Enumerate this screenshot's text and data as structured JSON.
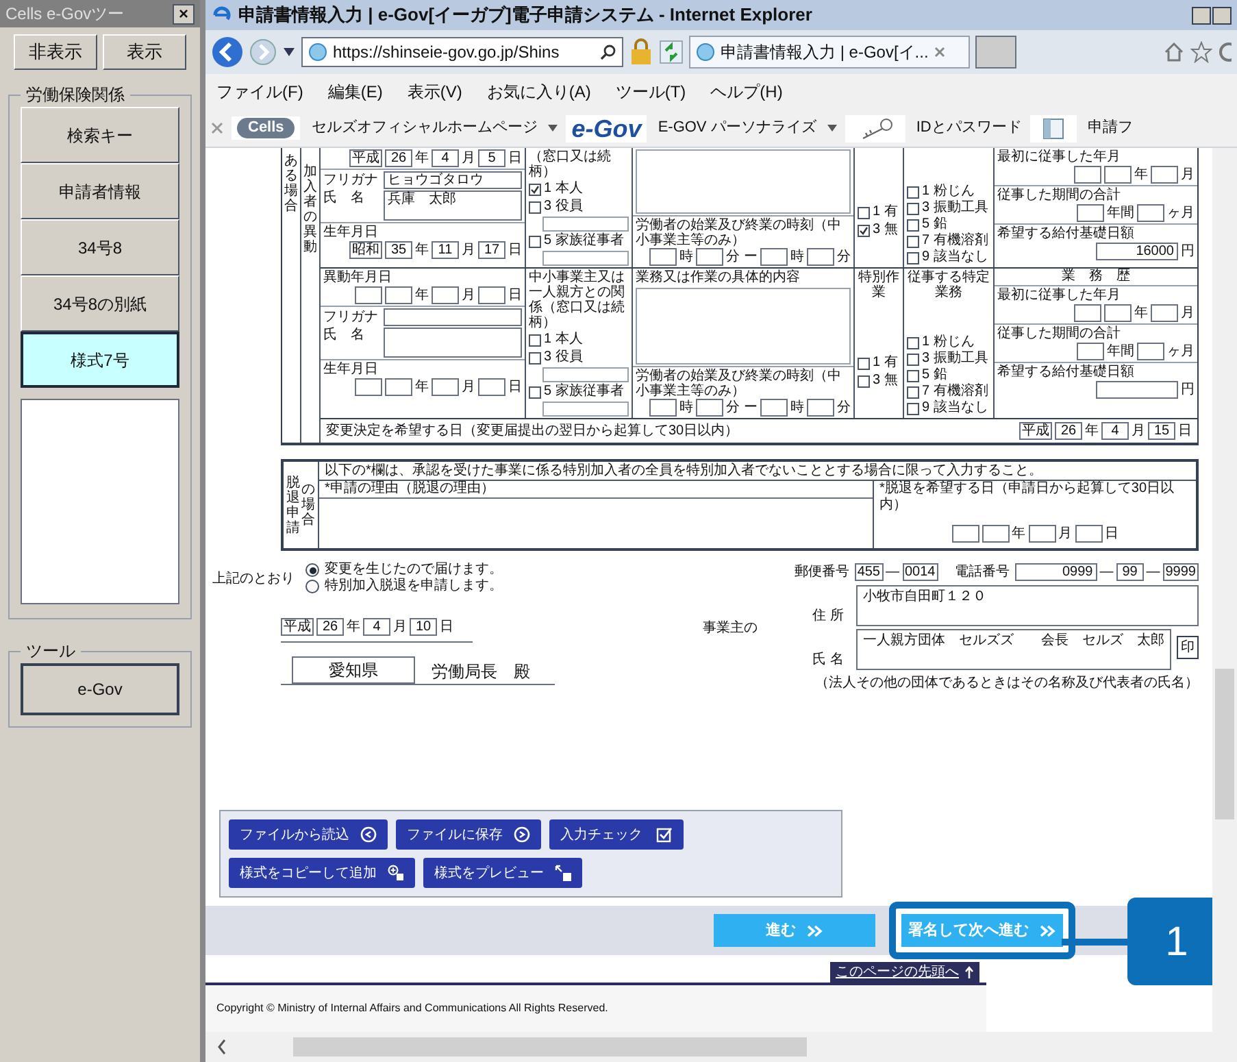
{
  "side_panel": {
    "title": "Cells e-Govツー",
    "close": "×",
    "toggle_buttons": [
      {
        "label": "非表示"
      },
      {
        "label": "表示"
      }
    ],
    "group_title": "労働保険関係",
    "items": [
      {
        "label": "検索キー",
        "selected": false
      },
      {
        "label": "申請者情報",
        "selected": false
      },
      {
        "label": "34号8",
        "selected": false
      },
      {
        "label": "34号8の別紙",
        "selected": false
      },
      {
        "label": "様式7号",
        "selected": true
      }
    ],
    "tool_group_title": "ツール",
    "tool_button": "e-Gov"
  },
  "browser": {
    "title": "申請書情報入力 | e-Gov[イーガブ]電子申請システム - Internet Explorer",
    "address": "https://shinseie-gov.go.jp/Shins",
    "tab": "申請書情報入力 | e-Gov[イ...",
    "menu": [
      "ファイル(F)",
      "編集(E)",
      "表示(V)",
      "お気に入り(A)",
      "ツール(T)",
      "ヘルプ(H)"
    ],
    "favorites": [
      {
        "kind": "cells",
        "logo": "Cells",
        "label": "セルズオフィシャルホームページ",
        "dropdown": true
      },
      {
        "kind": "egov",
        "logo": "e-Gov",
        "label": "E-GOV パーソナライズ",
        "dropdown": true
      },
      {
        "kind": "key",
        "label": "IDとパスワード",
        "dropdown": false
      },
      {
        "kind": "book",
        "label": "申請フ",
        "dropdown": false
      }
    ]
  },
  "form": {
    "outer_label": "ある場合",
    "inner_label": "加入者の異動",
    "persons": [
      {
        "date": [
          {
            "kind": "box",
            "value": "平成"
          },
          {
            "kind": "box",
            "value": "26"
          },
          {
            "kind": "unit",
            "text": "年"
          },
          {
            "kind": "box",
            "value": "4"
          },
          {
            "kind": "unit",
            "text": "月"
          },
          {
            "kind": "box",
            "value": "5"
          },
          {
            "kind": "unit",
            "text": "日"
          }
        ],
        "furigana_label": "フリガナ",
        "furigana": "ヒョウゴタロウ",
        "name_label": "氏　名",
        "name": "兵庫　太郎",
        "birth_label": "生年月日",
        "birth": [
          {
            "kind": "box",
            "value": "昭和"
          },
          {
            "kind": "box",
            "value": "35"
          },
          {
            "kind": "unit",
            "text": "年"
          },
          {
            "kind": "box",
            "value": "11"
          },
          {
            "kind": "unit",
            "text": "月"
          },
          {
            "kind": "box",
            "value": "17"
          },
          {
            "kind": "unit",
            "text": "日"
          }
        ],
        "relation_label": "（窓口又は続柄）",
        "relations": [
          {
            "label": "1 本人",
            "checked": true
          },
          {
            "label": "3 役員",
            "checked": false
          },
          {
            "label": "5 家族従事者",
            "checked": false
          }
        ],
        "hours_label": "労働者の始業及び終業の時刻（中小事業主等のみ）",
        "hours": [
          {
            "kind": "box"
          },
          {
            "kind": "unit",
            "text": "時"
          },
          {
            "kind": "box"
          },
          {
            "kind": "unit",
            "text": "分 ー"
          },
          {
            "kind": "box"
          },
          {
            "kind": "unit",
            "text": "時"
          },
          {
            "kind": "box"
          },
          {
            "kind": "unit",
            "text": "分"
          }
        ],
        "specials": [
          {
            "label": "1 有",
            "checked": false
          },
          {
            "label": "3 無",
            "checked": true
          }
        ],
        "jobs": [
          {
            "label": "1 粉じん",
            "checked": false
          },
          {
            "label": "3 振動工具",
            "checked": false
          },
          {
            "label": "5 鉛",
            "checked": false
          },
          {
            "label": "7 有機溶剤",
            "checked": false
          },
          {
            "label": "9 該当なし",
            "checked": false
          }
        ],
        "first_label": "最初に従事した年月",
        "first": [
          {
            "kind": "box"
          },
          {
            "kind": "box"
          },
          {
            "kind": "unit",
            "text": "年"
          },
          {
            "kind": "box"
          },
          {
            "kind": "unit",
            "text": "月"
          }
        ],
        "period_label": "従事した期間の合計",
        "period": [
          {
            "kind": "box"
          },
          {
            "kind": "unit",
            "text": "年間"
          },
          {
            "kind": "box"
          },
          {
            "kind": "unit",
            "text": "ヶ月"
          }
        ],
        "daily_label": "希望する給付基礎日額",
        "daily": [
          {
            "kind": "wide",
            "value": "16000"
          },
          {
            "kind": "unit",
            "text": "円"
          }
        ]
      },
      {
        "date_label": "異動年月日",
        "date": [
          {
            "kind": "box"
          },
          {
            "kind": "box"
          },
          {
            "kind": "unit",
            "text": "年"
          },
          {
            "kind": "box"
          },
          {
            "kind": "unit",
            "text": "月"
          },
          {
            "kind": "box"
          },
          {
            "kind": "unit",
            "text": "日"
          }
        ],
        "furigana_label": "フリガナ",
        "name_label": "氏　名",
        "birth_label": "生年月日",
        "birth": [
          {
            "kind": "box"
          },
          {
            "kind": "box"
          },
          {
            "kind": "unit",
            "text": "年"
          },
          {
            "kind": "box"
          },
          {
            "kind": "unit",
            "text": "月"
          },
          {
            "kind": "box"
          },
          {
            "kind": "unit",
            "text": "日"
          }
        ],
        "relation_label": "中小事業主又は一人親方との関係（窓口又は続柄）",
        "relations": [
          {
            "label": "1 本人",
            "checked": false
          },
          {
            "label": "3 役員",
            "checked": false
          },
          {
            "label": "5 家族従事者",
            "checked": false
          }
        ],
        "work_label": "業務又は作業の具体的内容",
        "hours_label": "労働者の始業及び終業の時刻（中小事業主等のみ）",
        "hours": [
          {
            "kind": "box"
          },
          {
            "kind": "unit",
            "text": "時"
          },
          {
            "kind": "box"
          },
          {
            "kind": "unit",
            "text": "分 ー"
          },
          {
            "kind": "box"
          },
          {
            "kind": "unit",
            "text": "時"
          },
          {
            "kind": "box"
          },
          {
            "kind": "unit",
            "text": "分"
          }
        ],
        "special_header": "特別作業",
        "specials": [
          {
            "label": "1 有",
            "checked": false
          },
          {
            "label": "3 無",
            "checked": false
          }
        ],
        "jobs_header": "従事する特定業務",
        "jobs": [
          {
            "label": "1 粉じん",
            "checked": false
          },
          {
            "label": "3 振動工具",
            "checked": false
          },
          {
            "label": "5 鉛",
            "checked": false
          },
          {
            "label": "7 有機溶剤",
            "checked": false
          },
          {
            "label": "9 該当なし",
            "checked": false
          }
        ],
        "history_header": "業　務　歴",
        "first_label": "最初に従事した年月",
        "first": [
          {
            "kind": "box"
          },
          {
            "kind": "box"
          },
          {
            "kind": "unit",
            "text": "年"
          },
          {
            "kind": "box"
          },
          {
            "kind": "unit",
            "text": "月"
          }
        ],
        "period_label": "従事した期間の合計",
        "period": [
          {
            "kind": "box"
          },
          {
            "kind": "unit",
            "text": "年間"
          },
          {
            "kind": "box"
          },
          {
            "kind": "unit",
            "text": "ヶ月"
          }
        ],
        "daily_label": "希望する給付基礎日額",
        "daily": [
          {
            "kind": "wide"
          },
          {
            "kind": "unit",
            "text": "円"
          }
        ]
      }
    ],
    "change_label": "変更決定を希望する日（変更届提出の翌日から起算して30日以内）",
    "change_date": [
      {
        "kind": "box",
        "value": "平成"
      },
      {
        "kind": "box",
        "value": "26"
      },
      {
        "kind": "unit",
        "text": "年"
      },
      {
        "kind": "box",
        "value": "4"
      },
      {
        "kind": "unit",
        "text": "月"
      },
      {
        "kind": "box",
        "value": "15"
      },
      {
        "kind": "unit",
        "text": "日"
      }
    ],
    "withdraw": {
      "label_left": "脱退申請",
      "label_right": "の場合",
      "notice": "以下の*欄は、承認を受けた事業に係る特別加入者の全員を特別加入者でないこととする場合に限って入力すること。",
      "reason_label": "*申請の理由（脱退の理由）",
      "date_label": "*脱退を希望する日（申請日から起算して30日以内）",
      "date": [
        {
          "kind": "box"
        },
        {
          "kind": "box"
        },
        {
          "kind": "unit",
          "text": "年"
        },
        {
          "kind": "box"
        },
        {
          "kind": "unit",
          "text": "月"
        },
        {
          "kind": "box"
        },
        {
          "kind": "unit",
          "text": "日"
        }
      ]
    },
    "declaration": {
      "label": "上記のとおり",
      "options": [
        {
          "label": "変更を生じたので届けます。",
          "selected": true
        },
        {
          "label": "特別加入脱退を申請します。",
          "selected": false
        }
      ],
      "date": [
        {
          "kind": "box",
          "value": "平成"
        },
        {
          "kind": "box",
          "value": "26"
        },
        {
          "kind": "unit",
          "text": "年"
        },
        {
          "kind": "box",
          "value": "4"
        },
        {
          "kind": "unit",
          "text": "月"
        },
        {
          "kind": "box",
          "value": "10"
        },
        {
          "kind": "unit",
          "text": "日"
        }
      ],
      "prefecture": "愛知県",
      "office": "労働局長",
      "honorific": "殿"
    },
    "employer": {
      "postal_label": "郵便番号",
      "postal": [
        {
          "kind": "box",
          "value": "455"
        },
        {
          "kind": "unit",
          "text": "—"
        },
        {
          "kind": "box",
          "value": "0014"
        }
      ],
      "phone_label": "電話番号",
      "phone": [
        {
          "kind": "wide",
          "value": "0999"
        },
        {
          "kind": "unit",
          "text": "—"
        },
        {
          "kind": "box",
          "value": "99"
        },
        {
          "kind": "unit",
          "text": "—"
        },
        {
          "kind": "box",
          "value": "9999"
        }
      ],
      "employer_label": "事業主の",
      "address_label": "住 所",
      "address": "小牧市自田町１２０",
      "name_label": "氏 名",
      "name": "一人親方団体　セルズズ　　会長　セルズ　太郎",
      "seal": "印",
      "note": "（法人その他の団体であるときはその名称及び代表者の氏名）"
    }
  },
  "actions": [
    {
      "kind": "read",
      "label": "ファイルから読込"
    },
    {
      "kind": "save",
      "label": "ファイルに保存"
    },
    {
      "kind": "check",
      "label": "入力チェック"
    },
    {
      "kind": "copy",
      "label": "様式をコピーして追加"
    },
    {
      "kind": "preview",
      "label": "様式をプレビュー"
    }
  ],
  "nav": [
    {
      "label": "進む",
      "highlighted": false
    },
    {
      "label": "署名して次へ進む",
      "highlighted": true
    }
  ],
  "callout": "1",
  "top_link": "このページの先頭へ",
  "copyright": "Copyright © Ministry of Internal Affairs and Communications All Rights Reserved."
}
